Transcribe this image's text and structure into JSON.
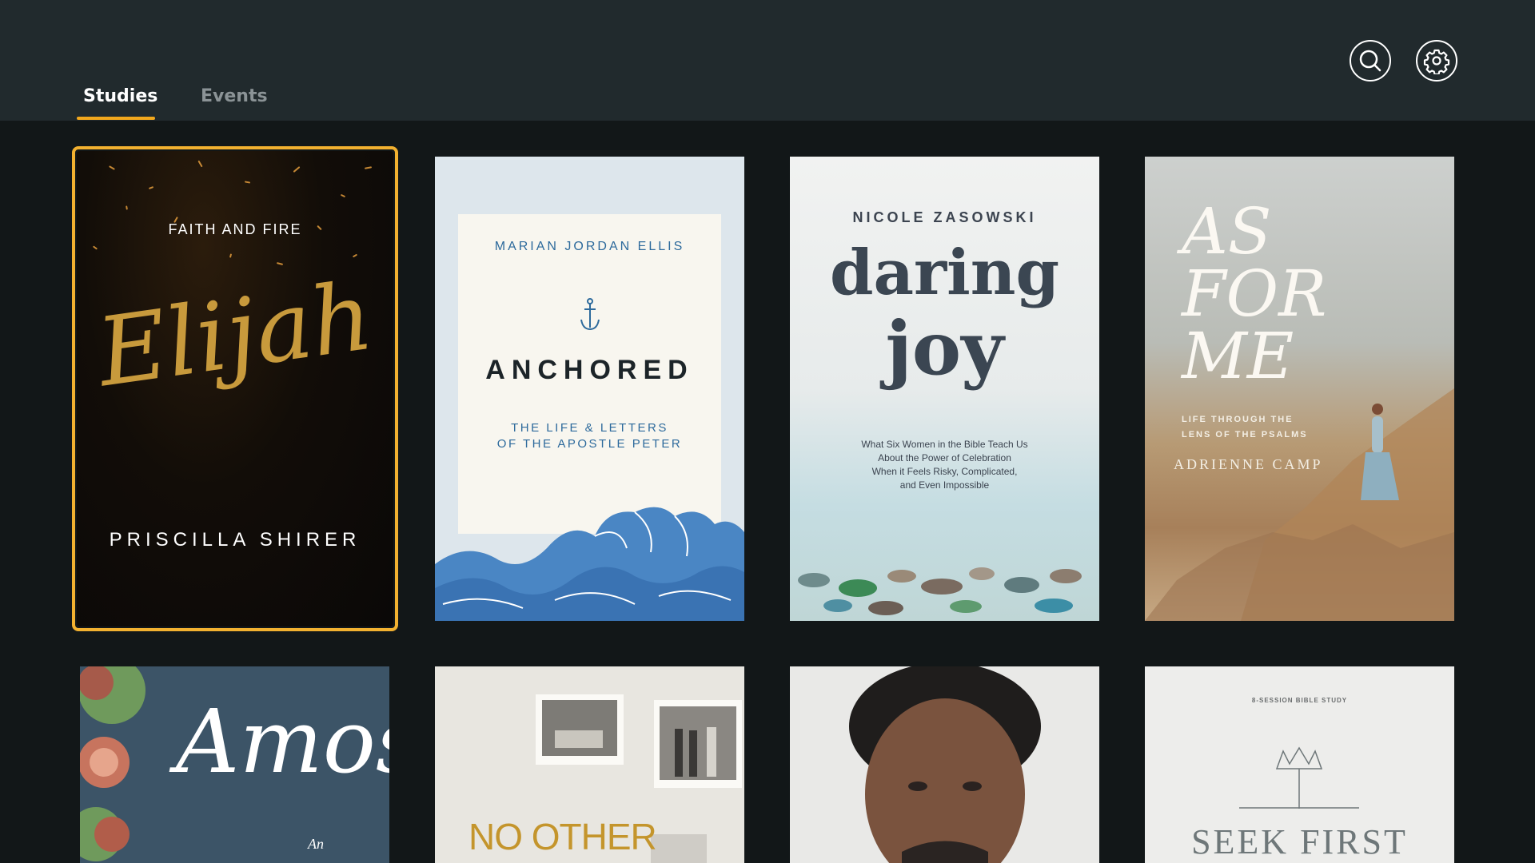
{
  "tabs": [
    {
      "label": "Studies",
      "active": true
    },
    {
      "label": "Events",
      "active": false
    }
  ],
  "header_icons": [
    "search-icon",
    "gear-icon"
  ],
  "colors": {
    "accent": "#f2b130",
    "header_bg": "#212a2d",
    "page_bg": "#121718"
  },
  "studies": [
    {
      "kicker": "FAITH AND FIRE",
      "title": "Elijah",
      "author": "PRISCILLA SHIRER",
      "selected": true
    },
    {
      "author": "MARIAN JORDAN ELLIS",
      "title": "ANCHORED",
      "subtitle": "THE LIFE & LETTERS\nOF THE APOSTLE PETER"
    },
    {
      "author": "NICOLE ZASOWSKI",
      "title_line1": "daring",
      "title_line2": "joy",
      "subtitle": "What Six Women in the Bible Teach Us\nAbout the Power of Celebration\nWhen it Feels Risky, Complicated,\nand Even Impossible"
    },
    {
      "title": "AS\nFOR\nME",
      "subtitle": "LIFE THROUGH THE\nLENS OF THE PSALMS",
      "author": "ADRIENNE CAMP"
    },
    {
      "title": "Amos",
      "subtitle": "An"
    },
    {
      "title": "NO OTHER"
    },
    {
      "title": ""
    },
    {
      "kicker": "8-SESSION BIBLE STUDY",
      "title": "SEEK FIRST"
    }
  ]
}
